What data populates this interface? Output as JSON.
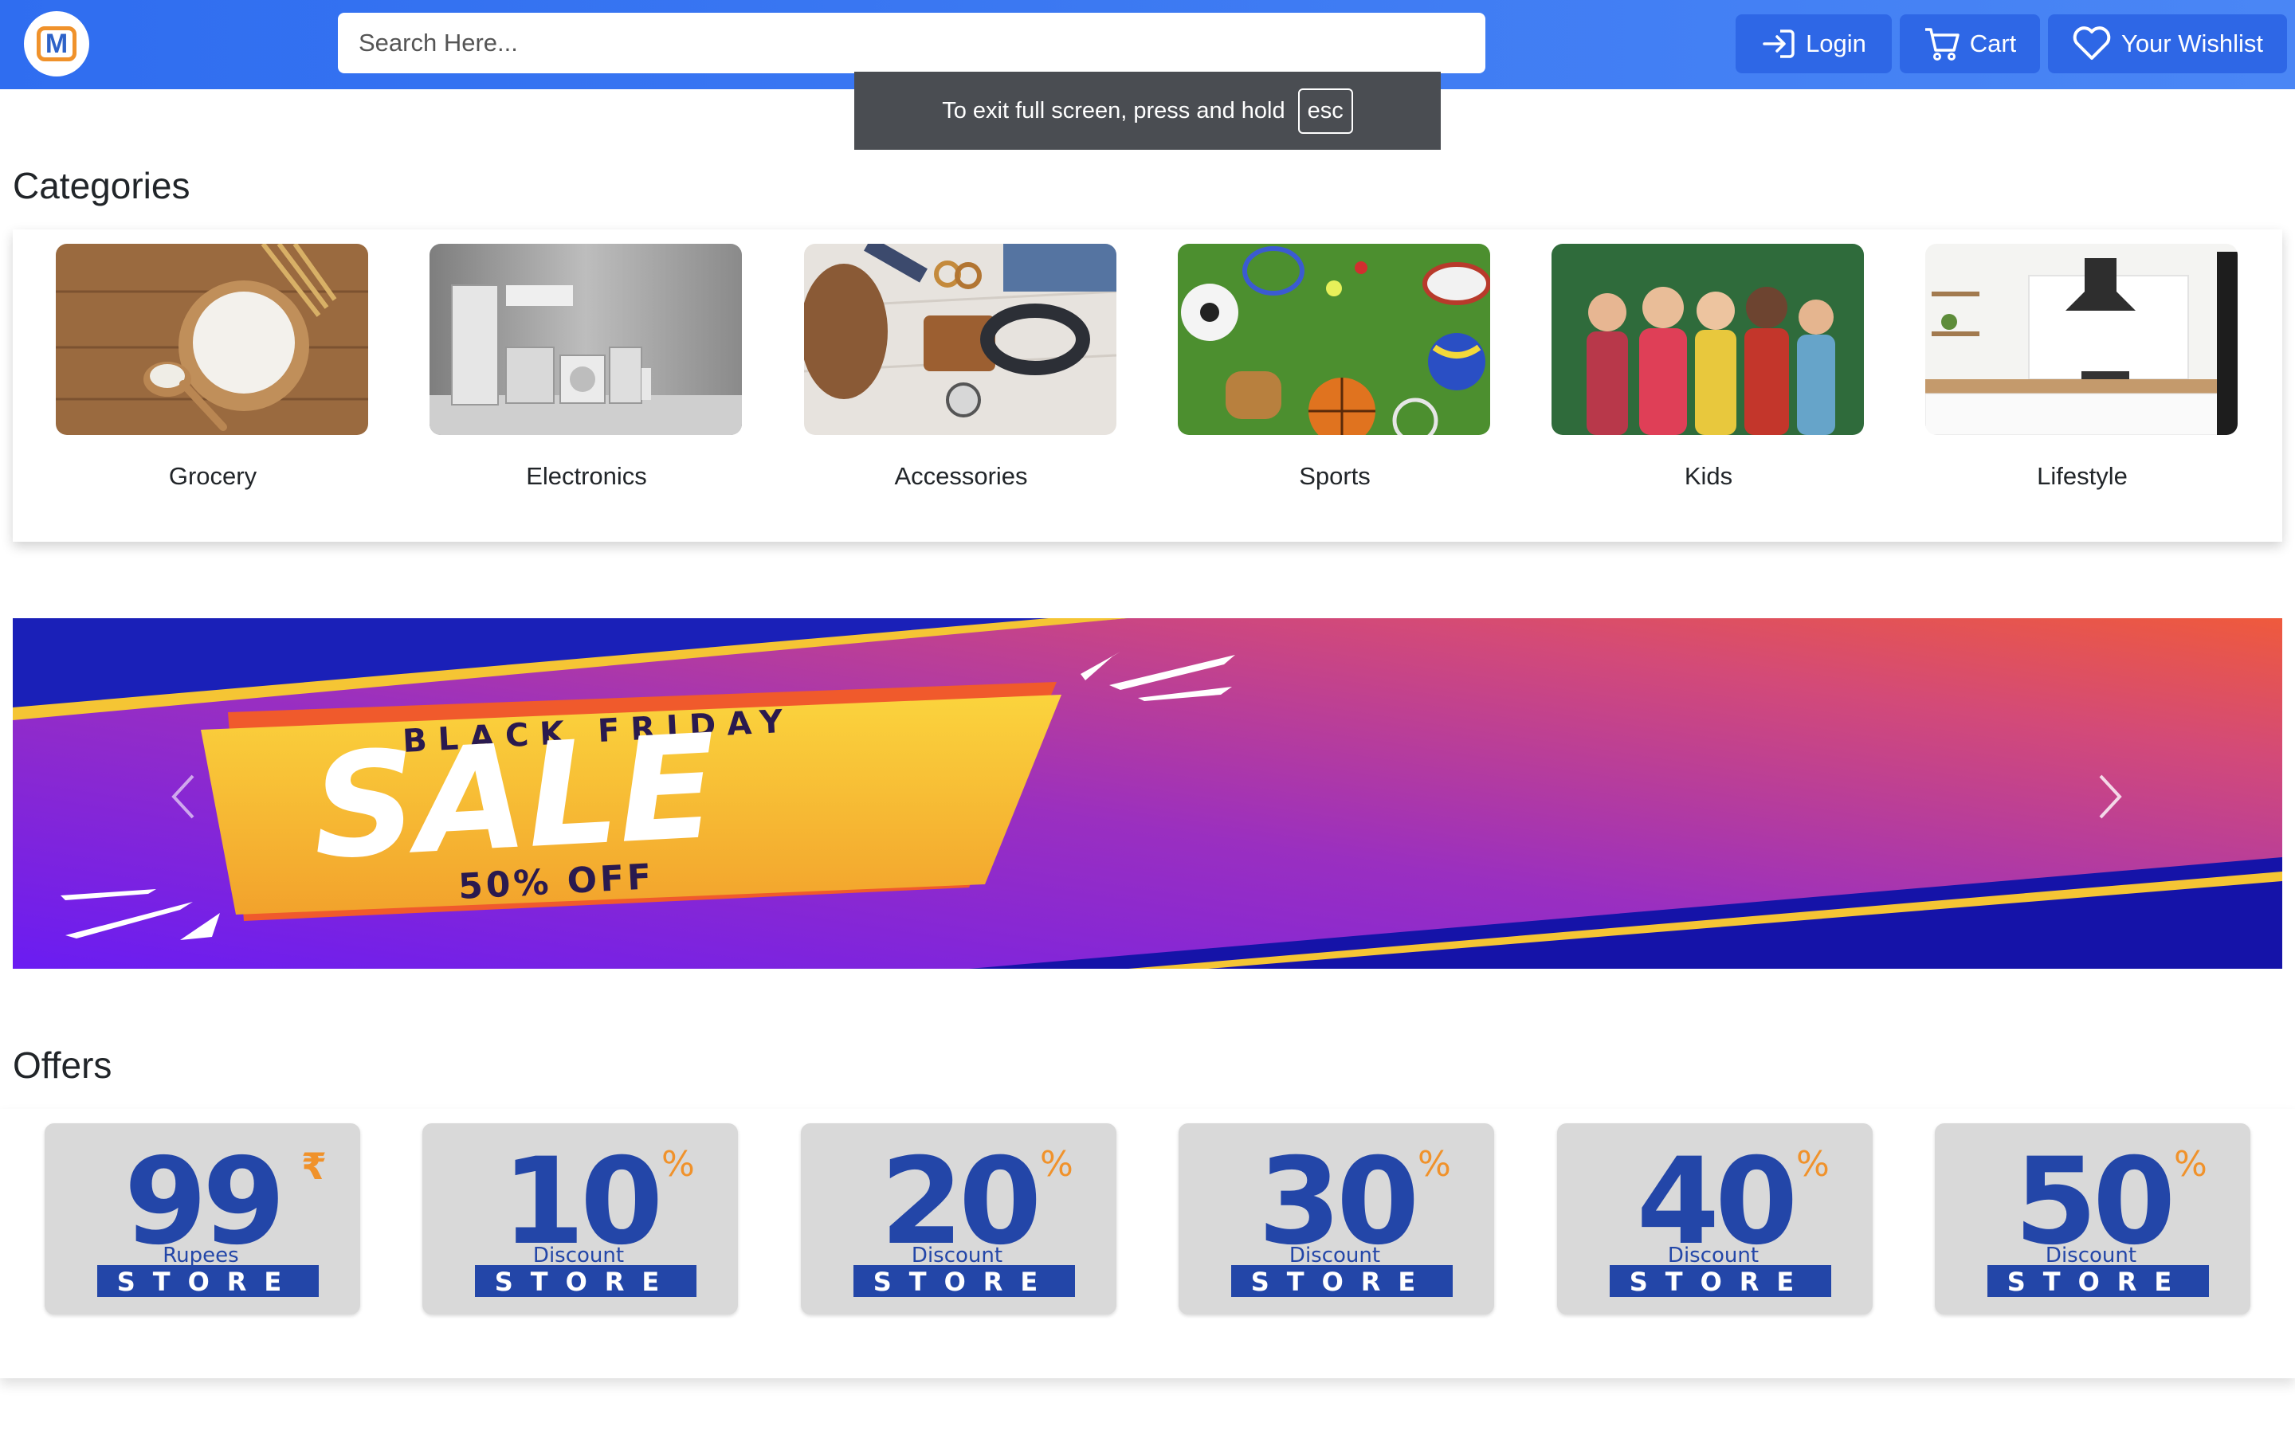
{
  "header": {
    "logo_letter": "M",
    "search_placeholder": "Search Here...",
    "login_label": "Login",
    "cart_label": "Cart",
    "wishlist_label": "Your Wishlist"
  },
  "fullscreen_notice": {
    "text": "To exit full screen, press and hold",
    "key": "esc"
  },
  "categories": {
    "title": "Categories",
    "items": [
      {
        "label": "Grocery"
      },
      {
        "label": "Electronics"
      },
      {
        "label": "Accessories"
      },
      {
        "label": "Sports"
      },
      {
        "label": "Kids"
      },
      {
        "label": "Lifestyle"
      }
    ]
  },
  "banner": {
    "top_text": "BLACK FRIDAY",
    "main_text": "SALE",
    "bottom_text": "50% OFF",
    "prev_icon": "chevron-left-icon",
    "next_icon": "chevron-right-icon"
  },
  "offers": {
    "title": "Offers",
    "items": [
      {
        "value": "99",
        "symbol": "₹",
        "subtitle": "Rupees",
        "store": "STORE"
      },
      {
        "value": "10",
        "symbol": "%",
        "subtitle": "Discount",
        "store": "STORE"
      },
      {
        "value": "20",
        "symbol": "%",
        "subtitle": "Discount",
        "store": "STORE"
      },
      {
        "value": "30",
        "symbol": "%",
        "subtitle": "Discount",
        "store": "STORE"
      },
      {
        "value": "40",
        "symbol": "%",
        "subtitle": "Discount",
        "store": "STORE"
      },
      {
        "value": "50",
        "symbol": "%",
        "subtitle": "Discount",
        "store": "STORE"
      }
    ]
  },
  "colors": {
    "nav_gradient_start": "#2f6df0",
    "nav_gradient_end": "#4a86f5",
    "nav_button": "#2e67e6",
    "offer_blue": "#2346a8",
    "offer_orange": "#f0922b",
    "banner_yellow": "#f7c531"
  }
}
